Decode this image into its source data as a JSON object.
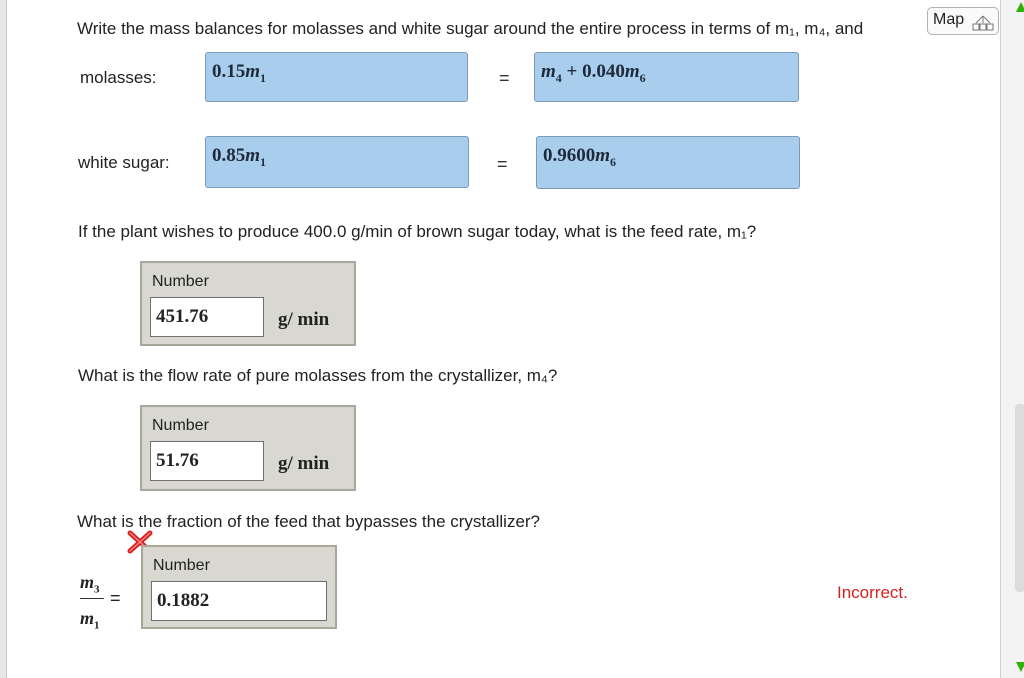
{
  "map_button": {
    "label": "Map"
  },
  "question1": {
    "text": "Write the mass balances for molasses and white sugar around the entire process in terms of m₁, m₄, and"
  },
  "balances": {
    "molasses": {
      "label": "molasses:",
      "left_coef": "0.15",
      "left_var": "m",
      "left_sub": "1",
      "equals": "=",
      "r_var1": "m",
      "r_sub1": "4",
      "r_mid": "+ 0.040",
      "r_var2": "m",
      "r_sub2": "6"
    },
    "white_sugar": {
      "label": "white sugar:",
      "left_coef": "0.85",
      "left_var": "m",
      "left_sub": "1",
      "equals": "=",
      "r_coef": "0.9600",
      "r_var": "m",
      "r_sub": "6"
    }
  },
  "question2": {
    "text": "If the plant wishes to produce 400.0 g/min of brown sugar today, what is the feed rate, m₁?"
  },
  "answer2": {
    "label": "Number",
    "value": "451.76",
    "unit": "g/ min"
  },
  "question3": {
    "text": "What is the flow rate of pure molasses from the crystallizer, m₄?"
  },
  "answer3": {
    "label": "Number",
    "value": "51.76",
    "unit": "g/ min"
  },
  "question4": {
    "text": "What is the fraction of the feed that bypasses the crystallizer?"
  },
  "fraction": {
    "num_var": "m",
    "num_sub": "3",
    "den_var": "m",
    "den_sub": "1",
    "equals": "="
  },
  "answer4": {
    "label": "Number",
    "value": "0.1882",
    "feedback": "Incorrect."
  },
  "colors": {
    "eq_box_fill": "#a9cdec",
    "answer_panel": "#d8d8d0",
    "incorrect": "#d42222",
    "scroll_arrow": "#2db200"
  }
}
